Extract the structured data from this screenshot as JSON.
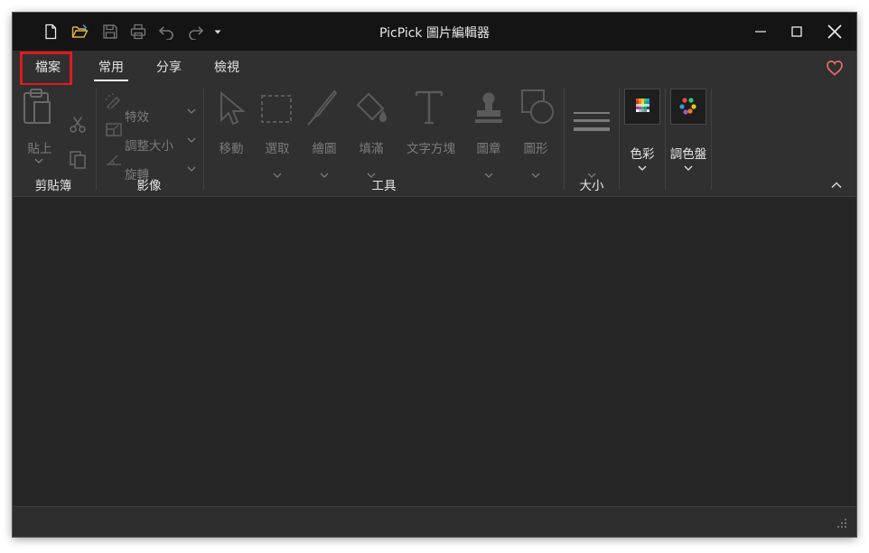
{
  "window": {
    "title": "PicPick 圖片編輯器"
  },
  "quick_access": [
    "new-file-icon",
    "open-folder-icon",
    "save-icon",
    "print-icon",
    "undo-icon",
    "redo-icon",
    "customize-dropdown-icon"
  ],
  "tabs": {
    "file": "檔案",
    "home": "常用",
    "share": "分享",
    "view": "檢視"
  },
  "ribbon": {
    "clipboard": {
      "group_label": "剪貼簿",
      "paste": "貼上"
    },
    "image": {
      "group_label": "影像",
      "effects": "特效",
      "resize": "調整大小",
      "rotate": "旋轉"
    },
    "tools": {
      "group_label": "工具",
      "items": [
        "移動",
        "選取",
        "繪圖",
        "填滿",
        "文字方塊",
        "圖章",
        "圖形"
      ]
    },
    "size": {
      "group_label": "大小"
    },
    "color": {
      "label": "色彩"
    },
    "palette": {
      "label": "調色盤"
    }
  },
  "colors": {
    "highlight": "#e0191f",
    "heart": "#e06a6a",
    "background": "#262626"
  }
}
